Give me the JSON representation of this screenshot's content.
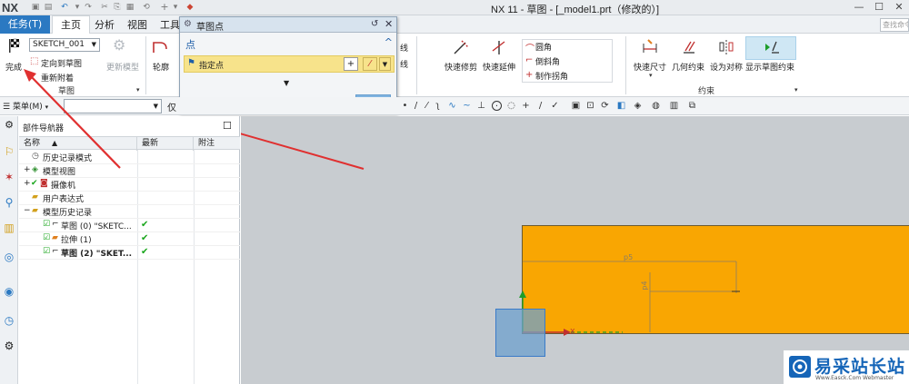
{
  "app": {
    "logo": "NX",
    "window_title": "NX 11 - 草图 - [_model1.prt（修改的）]",
    "search_placeholder": "查找命令"
  },
  "tabs": {
    "task": "任务(T)",
    "home": "主页",
    "analysis": "分析",
    "view": "视图",
    "tools": "工具"
  },
  "ribbon": {
    "sketch_name": "SKETCH_001",
    "finish": "完成",
    "orient_to_sketch": "定向到草图",
    "reattach": "重新附着",
    "update_model": "更新模型",
    "group_sketch": "草图",
    "profile": "轮廓",
    "line1": "线",
    "line2": "线",
    "quick_trim": "快速修剪",
    "quick_extend": "快速延伸",
    "fillet": "圆角",
    "chamfer": "倒斜角",
    "make_corner": "制作拐角",
    "rapid_dimension": "快速尺寸",
    "geometric_constraints": "几何约束",
    "make_symmetric": "设为对称",
    "show_sketch_constraints": "显示草图约束",
    "group_constraints": "约束"
  },
  "dialog": {
    "title": "草图点",
    "section": "点",
    "specify_point": "指定点",
    "close": "关闭"
  },
  "toolbar": {
    "menu": "菜单(M)",
    "filter_fragment": "仅"
  },
  "navigator": {
    "title": "部件导航器",
    "columns": [
      "名称",
      "最新",
      "附注"
    ],
    "rows": [
      {
        "label": "历史记录模式",
        "latest": ""
      },
      {
        "label": "模型视图",
        "latest": ""
      },
      {
        "label": "摄像机",
        "latest": ""
      },
      {
        "label": "用户表达式",
        "latest": ""
      },
      {
        "label": "模型历史记录",
        "latest": ""
      },
      {
        "label": "草图 (0) \"SKETC...",
        "latest": "✔"
      },
      {
        "label": "拉伸 (1)",
        "latest": "✔"
      },
      {
        "label": "草图 (2) \"SKET...",
        "latest": "✔"
      }
    ]
  },
  "canvas": {
    "dim_horizontal": "p5",
    "dim_vertical": "p4",
    "axis_x_label": "X"
  },
  "watermark": {
    "text": "易采站长站",
    "subtext": "Www.Easck.Com Webmaster"
  },
  "colors": {
    "accent": "#2b79c2",
    "solid_body": "#f9a602",
    "canvas_bg": "#c8ccd0",
    "check_green": "#19a61c",
    "arrow_red": "#e03030"
  }
}
